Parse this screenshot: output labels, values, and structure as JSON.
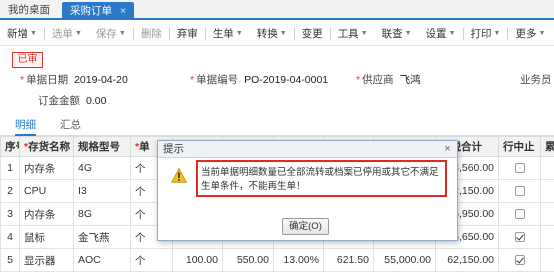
{
  "tabs": {
    "home": "我的桌面",
    "active": "采购订单",
    "close": "×"
  },
  "toolbar": [
    {
      "label": "新增",
      "caret": true,
      "disabled": false
    },
    {
      "label": "选单",
      "caret": true,
      "disabled": true
    },
    {
      "label": "保存",
      "caret": true,
      "disabled": true
    },
    {
      "label": "删除",
      "caret": false,
      "disabled": true
    },
    {
      "label": "弃审",
      "caret": false,
      "disabled": false
    },
    {
      "label": "生单",
      "caret": true,
      "disabled": false
    },
    {
      "label": "转换",
      "caret": true,
      "disabled": false
    },
    {
      "label": "变更",
      "caret": false,
      "disabled": false
    },
    {
      "label": "工具",
      "caret": true,
      "disabled": false
    },
    {
      "label": "联查",
      "caret": true,
      "disabled": false
    },
    {
      "label": "设置",
      "caret": true,
      "disabled": false
    },
    {
      "label": "打印",
      "caret": true,
      "disabled": false
    },
    {
      "label": "更多",
      "caret": true,
      "disabled": false
    }
  ],
  "status_stamp": "已审",
  "form": {
    "doc_date_label": "单据日期",
    "doc_date": "2019-04-20",
    "doc_no_label": "单据编号",
    "doc_no": "PO-2019-04-0001",
    "supplier_label": "供应商",
    "supplier": "飞鸿",
    "salesman_label": "业务员",
    "deposit_label": "订金金额",
    "deposit": "0.00"
  },
  "subtabs": {
    "detail": "明细",
    "summary": "汇总"
  },
  "table": {
    "headers": [
      "序号",
      "存货名称",
      "规格型号",
      "单",
      "",
      "",
      "",
      "",
      "",
      "价税合计",
      "行中止",
      "累"
    ],
    "rows": [
      {
        "no": "1",
        "name": "内存条",
        "spec": "4G",
        "unit": "个",
        "qty": "",
        "price": "",
        "rate": "",
        "tax": "",
        "amount": "",
        "total": "53,560.00",
        "stopped": false
      },
      {
        "no": "2",
        "name": "CPU",
        "spec": "I3",
        "unit": "个",
        "qty": "",
        "price": "",
        "rate": "",
        "tax": "",
        "amount": "",
        "total": "62,150.00",
        "stopped": false
      },
      {
        "no": "3",
        "name": "内存条",
        "spec": "8G",
        "unit": "个",
        "qty": "",
        "price": "",
        "rate": "",
        "tax": "",
        "amount": "",
        "total": "56,950.00",
        "stopped": false
      },
      {
        "no": "4",
        "name": "鼠标",
        "spec": "金飞燕",
        "unit": "个",
        "qty": "",
        "price": "",
        "rate": "",
        "tax": "",
        "amount": "",
        "total": "5,650.00",
        "stopped": true
      },
      {
        "no": "5",
        "name": "显示器",
        "spec": "AOC",
        "unit": "个",
        "qty": "100.00",
        "price": "550.00",
        "rate": "13.00%",
        "tax": "621.50",
        "amount": "55,000.00",
        "total": "62,150.00",
        "stopped": true
      }
    ]
  },
  "dialog": {
    "title": "提示",
    "close": "×",
    "message": "当前单据明细数量已全部流转或档案已停用或其它不满足生单条件，不能再生单！",
    "ok_label": "确定(O)",
    "icon": "warning-icon"
  },
  "colors": {
    "accent": "#2b79c8",
    "highlight_red": "#e02b22",
    "warning_yellow": "#f2c21b"
  }
}
